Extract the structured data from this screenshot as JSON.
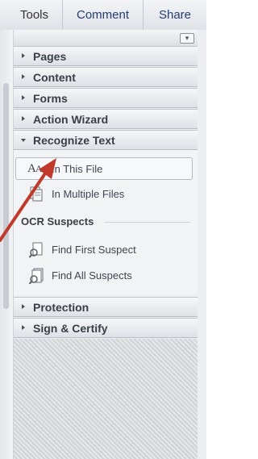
{
  "tabs": {
    "tools": "Tools",
    "comment": "Comment",
    "share": "Share"
  },
  "panels": [
    {
      "label": "Pages"
    },
    {
      "label": "Content"
    },
    {
      "label": "Forms"
    },
    {
      "label": "Action Wizard"
    },
    {
      "label": "Recognize Text"
    }
  ],
  "recognize_text": {
    "in_this_file": "In This File",
    "in_multiple_files": "In Multiple Files",
    "ocr_suspects": "OCR Suspects",
    "find_first_suspect": "Find First Suspect",
    "find_all_suspects": "Find All Suspects"
  },
  "lower_panels": [
    {
      "label": "Protection"
    },
    {
      "label": "Sign & Certify"
    }
  ],
  "colors": {
    "annotation_arrow": "#c0392b"
  }
}
